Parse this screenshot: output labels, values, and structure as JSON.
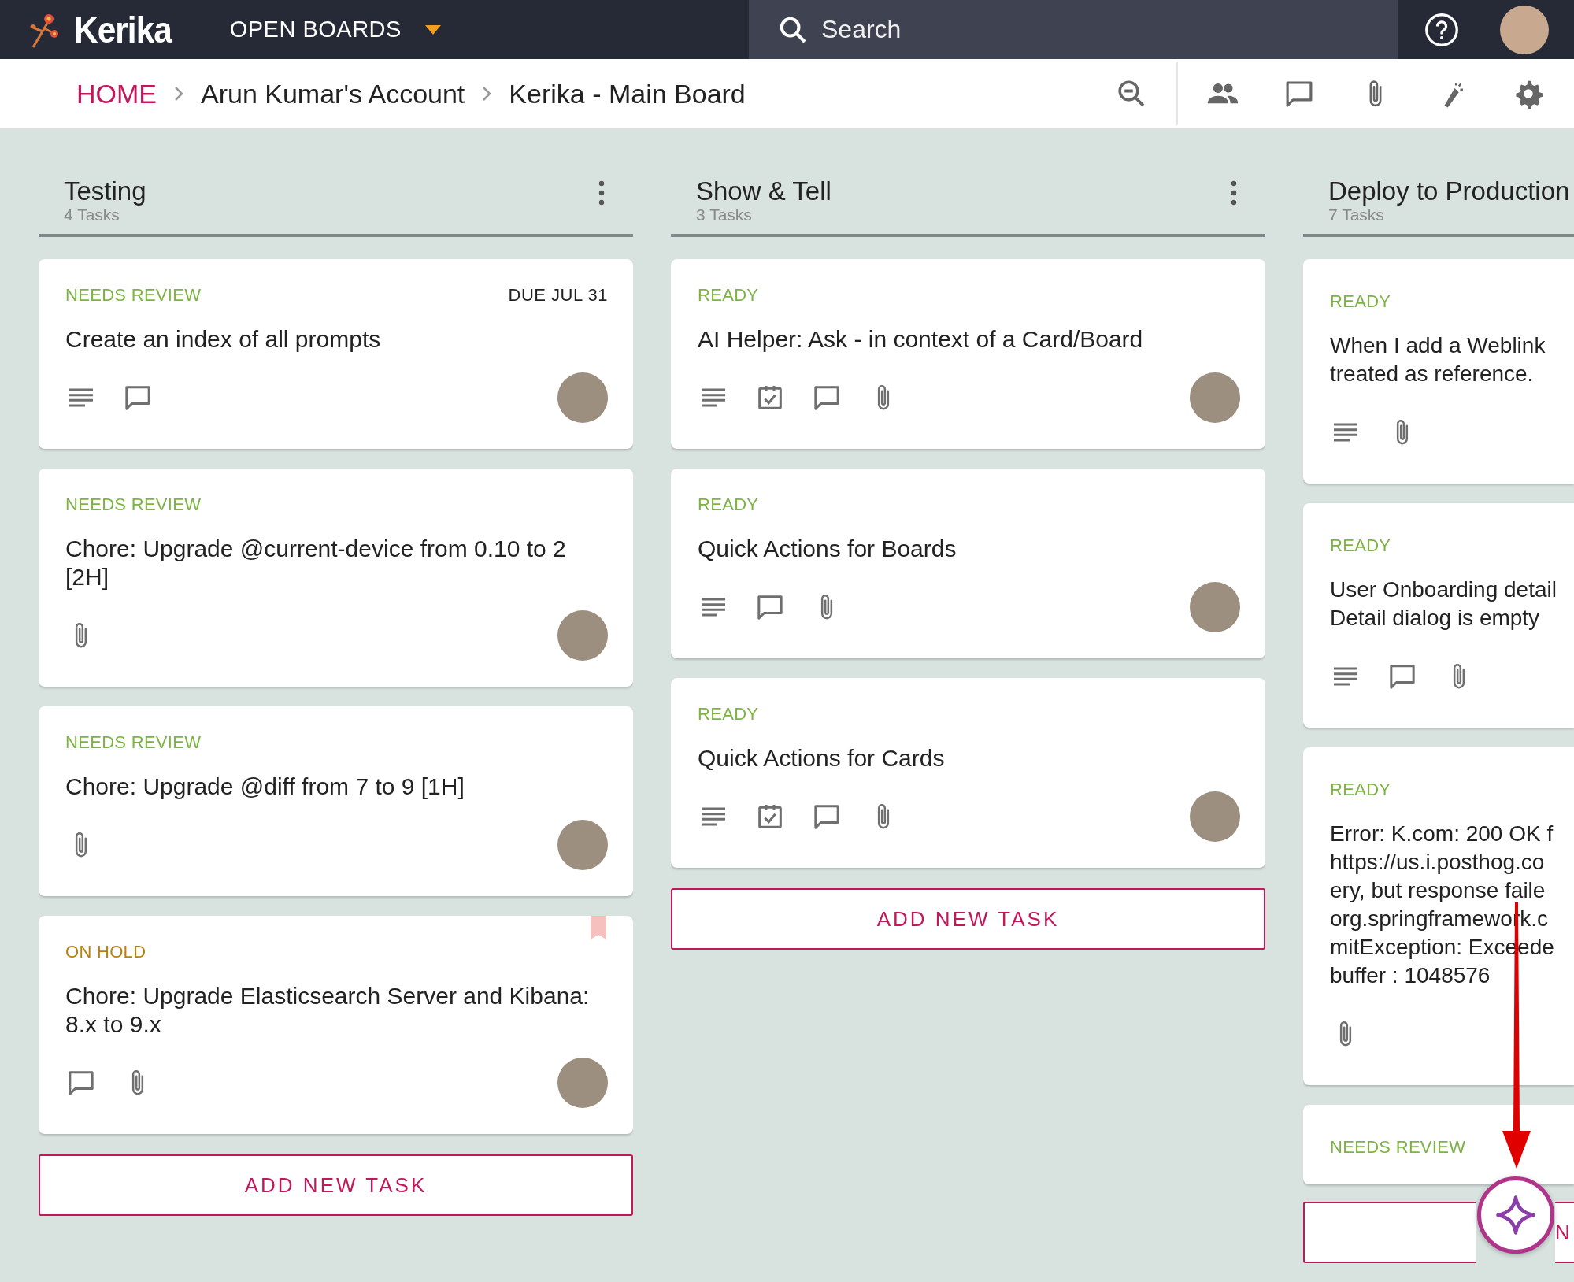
{
  "top_bar": {
    "app_name": "Kerika",
    "boards_menu": "OPEN BOARDS",
    "search": {
      "placeholder": "Search"
    }
  },
  "breadcrumbs": [
    {
      "label": "HOME",
      "kind": "home"
    },
    {
      "label": "Arun Kumar's Account",
      "kind": "crumb"
    },
    {
      "label": "Kerika - Main Board",
      "kind": "crumb"
    }
  ],
  "columns": [
    {
      "title": "Testing",
      "task_count": "4 Tasks",
      "menu": true,
      "add_button": "ADD NEW TASK",
      "cards": [
        {
          "status": "NEEDS REVIEW",
          "color": "#7cb342",
          "due": "DUE JUL 31",
          "title": "Create an index of all prompts",
          "description": true,
          "checklist": false,
          "comment": true,
          "attachment": false,
          "assignee": true,
          "flagged": false
        },
        {
          "status": "NEEDS REVIEW",
          "color": "#7cb342",
          "title": "Chore: Upgrade @current-device from 0.10 to 2\n[2H]",
          "description": false,
          "checklist": false,
          "comment": false,
          "attachment": true,
          "assignee": true,
          "flagged": false
        },
        {
          "status": "NEEDS REVIEW",
          "color": "#7cb342",
          "title": "Chore: Upgrade @diff from 7 to 9 [1H]",
          "description": false,
          "checklist": false,
          "comment": false,
          "attachment": true,
          "assignee": true,
          "flagged": false
        },
        {
          "status": "ON HOLD",
          "color": "#b7800f",
          "title": "Chore: Upgrade Elasticsearch Server and Kibana:\n8.x to 9.x",
          "description": false,
          "checklist": false,
          "comment": true,
          "attachment": true,
          "assignee": true,
          "flagged": true
        }
      ]
    },
    {
      "title": "Show & Tell",
      "task_count": "3 Tasks",
      "menu": true,
      "add_button": "ADD NEW TASK",
      "cards": [
        {
          "status": "READY",
          "color": "#7cb342",
          "title": "AI Helper: Ask - in context of a Card/Board",
          "description": true,
          "checklist": true,
          "comment": true,
          "attachment": true,
          "assignee": true,
          "flagged": false
        },
        {
          "status": "READY",
          "color": "#7cb342",
          "title": "Quick Actions for Boards",
          "description": true,
          "checklist": false,
          "comment": true,
          "attachment": true,
          "assignee": true,
          "flagged": false
        },
        {
          "status": "READY",
          "color": "#7cb342",
          "title": "Quick Actions for Cards",
          "description": true,
          "checklist": true,
          "comment": true,
          "attachment": true,
          "assignee": true,
          "flagged": false
        }
      ]
    },
    {
      "title": "Deploy to Production",
      "task_count": "7 Tasks",
      "menu": false,
      "add_button": "N",
      "cards": [
        {
          "status": "READY",
          "color": "#7cb342",
          "title": "When I add a Weblink\ntreated as reference.",
          "description": true,
          "checklist": false,
          "comment": false,
          "attachment": true,
          "assignee": false,
          "flagged": false
        },
        {
          "status": "READY",
          "color": "#7cb342",
          "title": "User Onboarding detail\nDetail dialog is empty",
          "description": true,
          "checklist": false,
          "comment": true,
          "attachment": true,
          "assignee": false,
          "flagged": false
        },
        {
          "status": "READY",
          "color": "#7cb342",
          "title": "Error: K.com: 200 OK f\nhttps://us.i.posthog.co\nery, but response faile\norg.springframework.c\nmitException: Exceede\nbuffer : 1048576",
          "description": false,
          "checklist": false,
          "comment": false,
          "attachment": true,
          "assignee": false,
          "flagged": false
        },
        {
          "status": "NEEDS REVIEW",
          "color": "#7cb342",
          "assignee": false,
          "flagged": false
        }
      ]
    }
  ]
}
